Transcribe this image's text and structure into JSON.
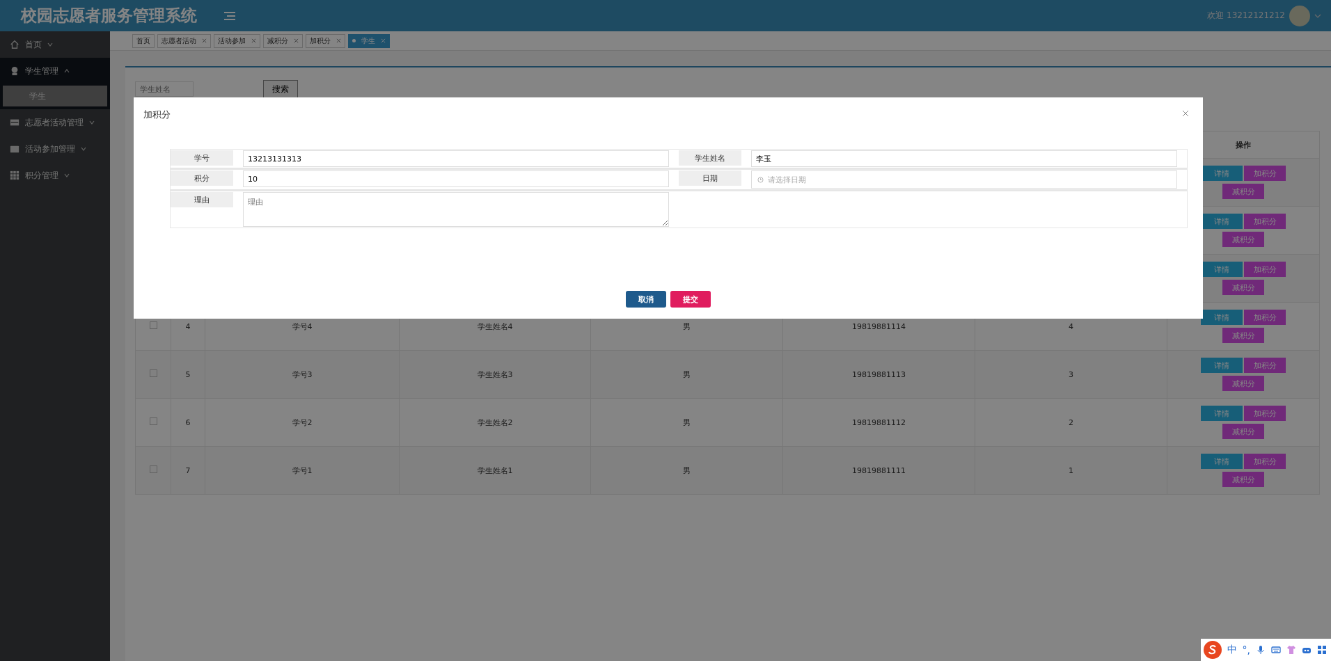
{
  "header": {
    "title": "校园志愿者服务管理系统",
    "welcome": "欢迎 13212121212"
  },
  "sidebar": {
    "items": [
      {
        "label": "首页",
        "expanded": false
      },
      {
        "label": "学生管理",
        "expanded": true,
        "children": [
          {
            "label": "学生",
            "selected": true
          }
        ]
      },
      {
        "label": "志愿者活动管理",
        "expanded": false
      },
      {
        "label": "活动参加管理",
        "expanded": false
      },
      {
        "label": "积分管理",
        "expanded": false
      }
    ]
  },
  "tabs": [
    {
      "label": "首页",
      "closable": false,
      "selected": false
    },
    {
      "label": "志愿者活动",
      "closable": true,
      "selected": false
    },
    {
      "label": "活动参加",
      "closable": true,
      "selected": false
    },
    {
      "label": "减积分",
      "closable": true,
      "selected": false
    },
    {
      "label": "加积分",
      "closable": true,
      "selected": false
    },
    {
      "label": "学生",
      "closable": true,
      "selected": true
    }
  ],
  "search": {
    "placeholder": "学生姓名",
    "button": "搜索"
  },
  "table": {
    "action_column": "操作",
    "rows": [
      {
        "actions": [
          "详情",
          "加积分",
          "减积分"
        ]
      },
      {
        "actions": [
          "详情",
          "加积分",
          "减积分"
        ]
      },
      {
        "actions": [
          "详情",
          "加积分",
          "减积分"
        ]
      },
      {
        "checked": false,
        "index": "4",
        "student_no": "学号4",
        "name": "学生姓名4",
        "gender": "男",
        "phone": "19819881114",
        "column_7": "4",
        "actions": [
          "详情",
          "加积分",
          "减积分"
        ]
      },
      {
        "checked": false,
        "index": "5",
        "student_no": "学号3",
        "name": "学生姓名3",
        "gender": "男",
        "phone": "19819881113",
        "column_7": "3",
        "actions": [
          "详情",
          "加积分",
          "减积分"
        ]
      },
      {
        "checked": false,
        "index": "6",
        "student_no": "学号2",
        "name": "学生姓名2",
        "gender": "男",
        "phone": "19819881112",
        "column_7": "2",
        "actions": [
          "详情",
          "加积分",
          "减积分"
        ]
      },
      {
        "checked": false,
        "index": "7",
        "student_no": "学号1",
        "name": "学生姓名1",
        "gender": "男",
        "phone": "19819881111",
        "column_7": "1",
        "actions": [
          "详情",
          "加积分",
          "减积分"
        ]
      }
    ]
  },
  "modal": {
    "title": "加积分",
    "fields": [
      {
        "kind": "text",
        "label": "学号",
        "value": "13213131313"
      },
      {
        "kind": "text",
        "label": "学生姓名",
        "value": "李玉"
      },
      {
        "kind": "text",
        "label": "积分",
        "value": "10"
      },
      {
        "kind": "date",
        "label": "日期",
        "placeholder": "请选择日期"
      },
      {
        "kind": "textarea",
        "label": "理由",
        "placeholder": "理由"
      }
    ],
    "buttons": [
      {
        "kind": "cancel",
        "label": "取消"
      },
      {
        "kind": "submit",
        "label": "提交"
      }
    ]
  },
  "ime": {
    "mode": "中",
    "punctuation": "°,"
  }
}
